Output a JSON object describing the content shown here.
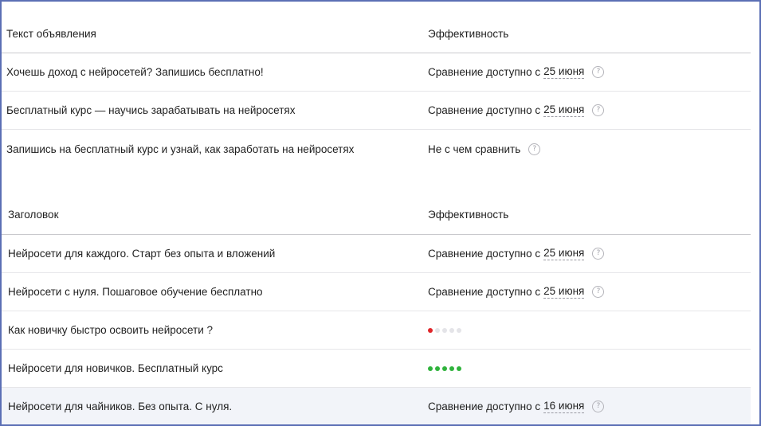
{
  "colors": {
    "red_dot": "#e0262a",
    "green_dot": "#2fb33c",
    "empty_dot": "#e4e4e8"
  },
  "ads": {
    "header": {
      "text": "Текст объявления",
      "effectiveness": "Эффективность"
    },
    "rows": [
      {
        "text": "Хочешь доход с нейросетей? Запишись бесплатно!",
        "eff_prefix": "Сравнение доступно с",
        "eff_date": "25 июня"
      },
      {
        "text": "Бесплатный курс — научись зарабатывать на нейросетях",
        "eff_prefix": "Сравнение доступно с",
        "eff_date": "25 июня"
      },
      {
        "text": "Запишись на бесплатный курс и узнай, как заработать на нейросетях",
        "eff_prefix": "Не с чем сравнить"
      }
    ]
  },
  "titles": {
    "header": {
      "text": "Заголовок",
      "effectiveness": "Эффективность"
    },
    "rows": [
      {
        "text": "Нейросети для каждого. Старт без опыта и вложений",
        "eff_prefix": "Сравнение доступно с",
        "eff_date": "25 июня"
      },
      {
        "text": "Нейросети с нуля. Пошаговое обучение бесплатно",
        "eff_prefix": "Сравнение доступно с",
        "eff_date": "25 июня"
      },
      {
        "text": "Как новичку быстро освоить нейросети ?",
        "rating": 1,
        "rating_max": 5,
        "rating_color": "red"
      },
      {
        "text": "Нейросети для новичков. Бесплатный курс",
        "rating": 5,
        "rating_max": 5,
        "rating_color": "green"
      },
      {
        "text": "Нейросети для чайников. Без опыта. С нуля.",
        "eff_prefix": "Сравнение доступно с",
        "eff_date": "16 июня"
      }
    ]
  }
}
